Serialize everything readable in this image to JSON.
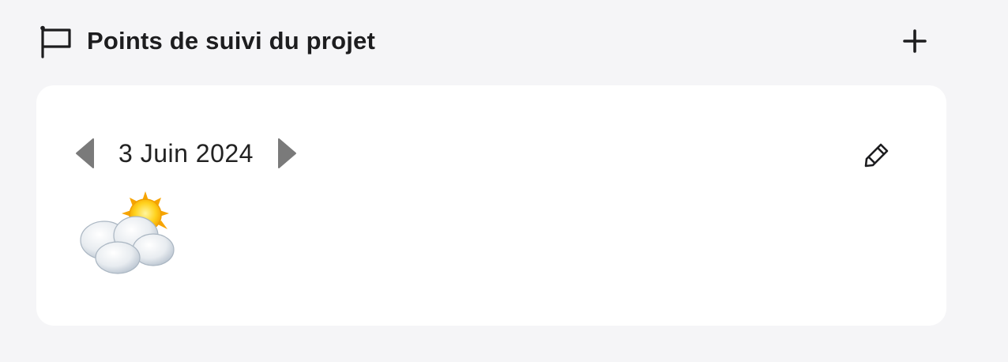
{
  "header": {
    "title": "Points de suivi du projet",
    "flag_icon": "flag-icon",
    "add_icon": "plus-icon"
  },
  "card": {
    "date": "3 Juin 2024",
    "prev_icon": "triangle-left-icon",
    "next_icon": "triangle-right-icon",
    "edit_icon": "pencil-icon",
    "weather_icon": "sun-behind-cloud-icon"
  },
  "colors": {
    "background": "#f5f5f7",
    "card": "#ffffff",
    "arrow": "#7a7a7a",
    "text": "#1d1d1f"
  }
}
